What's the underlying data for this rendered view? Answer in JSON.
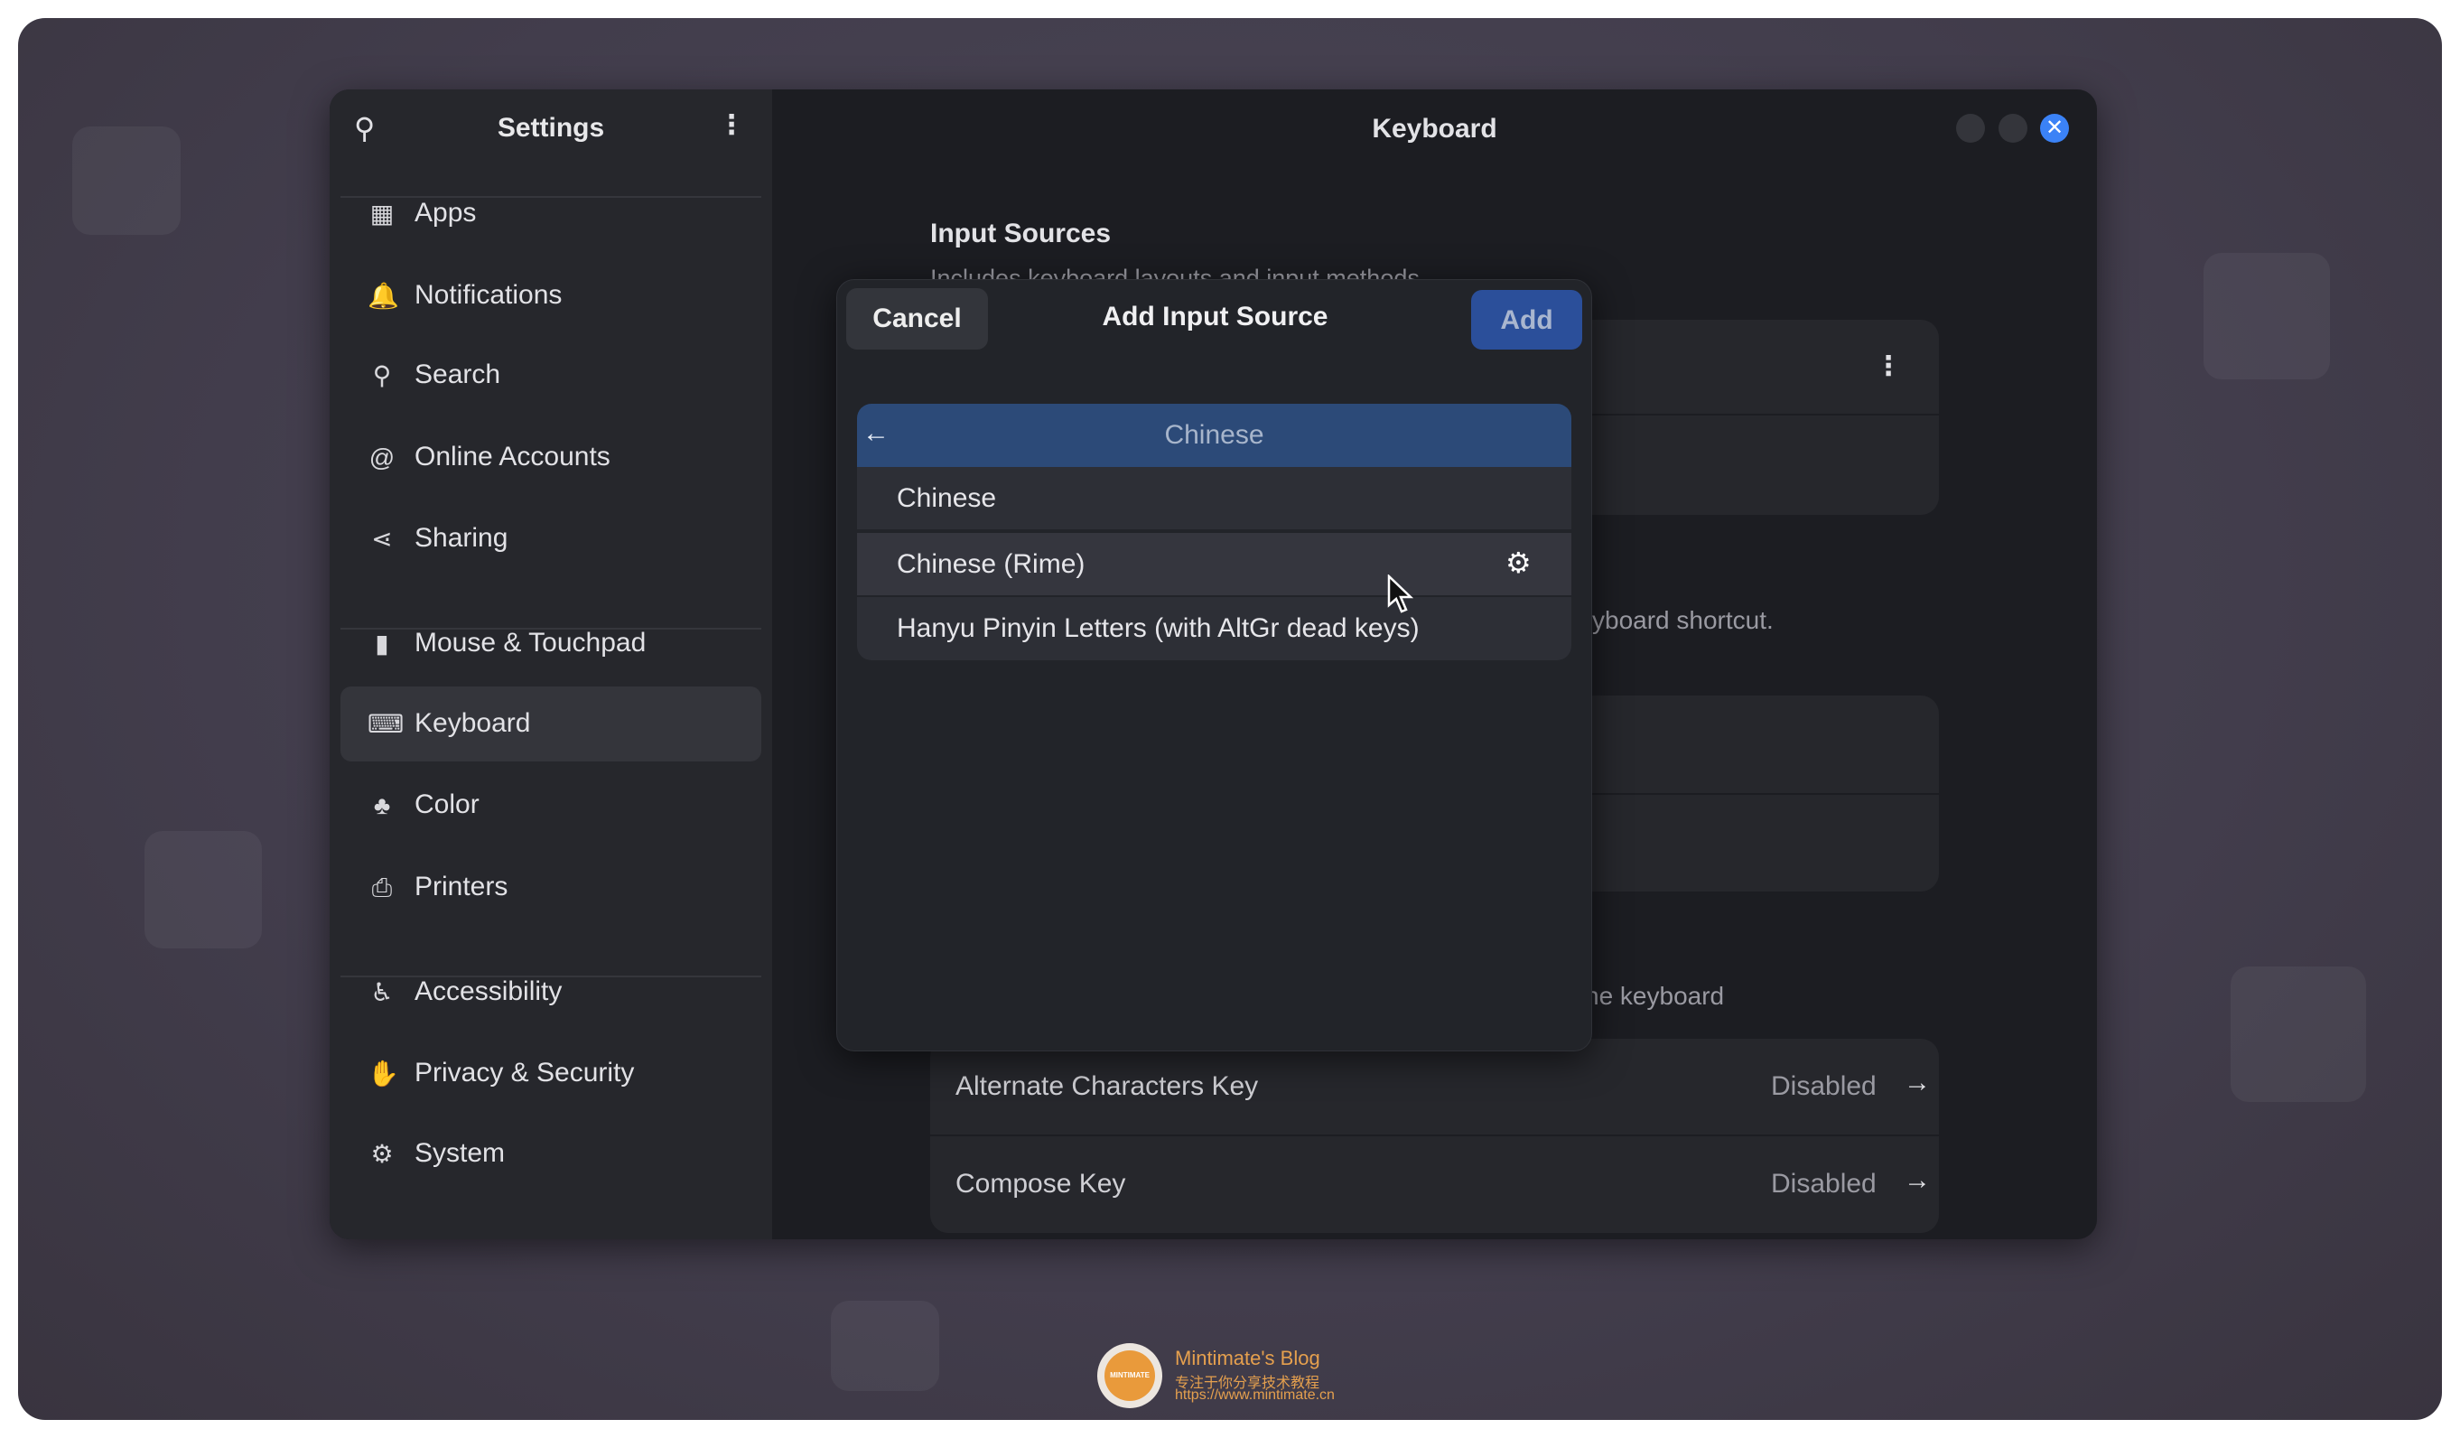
{
  "sidebar": {
    "title": "Settings",
    "items": [
      {
        "label": "Apps",
        "icon": "apps-icon",
        "glyph": "▦"
      },
      {
        "label": "Notifications",
        "icon": "bell-icon",
        "glyph": "🔔"
      },
      {
        "label": "Search",
        "icon": "search-icon",
        "glyph": "⚲"
      },
      {
        "label": "Online Accounts",
        "icon": "at-icon",
        "glyph": "@"
      },
      {
        "label": "Sharing",
        "icon": "share-icon",
        "glyph": "⋖"
      },
      {
        "label": "Mouse & Touchpad",
        "icon": "mouse-icon",
        "glyph": "▮"
      },
      {
        "label": "Keyboard",
        "icon": "keyboard-icon",
        "glyph": "⌨",
        "selected": true
      },
      {
        "label": "Color",
        "icon": "color-icon",
        "glyph": "♣"
      },
      {
        "label": "Printers",
        "icon": "printer-icon",
        "glyph": "⎙"
      },
      {
        "label": "Accessibility",
        "icon": "accessibility-icon",
        "glyph": "♿"
      },
      {
        "label": "Privacy & Security",
        "icon": "hand-icon",
        "glyph": "✋"
      },
      {
        "label": "System",
        "icon": "gear-icon",
        "glyph": "⚙"
      }
    ]
  },
  "main": {
    "title": "Keyboard",
    "input_sources_heading": "Input Sources",
    "input_sources_sub": "Includes keyboard layouts and input methods.",
    "switch_fragment": "yboard shortcut.",
    "special_fragment": "he keyboard",
    "rows": [
      {
        "label": "Alternate Characters Key",
        "value": "Disabled"
      },
      {
        "label": "Compose Key",
        "value": "Disabled"
      }
    ]
  },
  "dialog": {
    "title": "Add Input Source",
    "cancel": "Cancel",
    "add": "Add",
    "header": "Chinese",
    "items": [
      "Chinese",
      "Chinese (Rime)",
      "Hanyu Pinyin Letters (with AltGr dead keys)"
    ]
  },
  "watermark": {
    "name": "Mintimate's Blog",
    "tagline": "专注于你分享技术教程",
    "url": "https://www.mintimate.cn",
    "logo_text": "MINTIMATE"
  },
  "colors": {
    "accent": "#2b4f9a",
    "close": "#3b82f6",
    "list_header": "#2c4a78"
  }
}
